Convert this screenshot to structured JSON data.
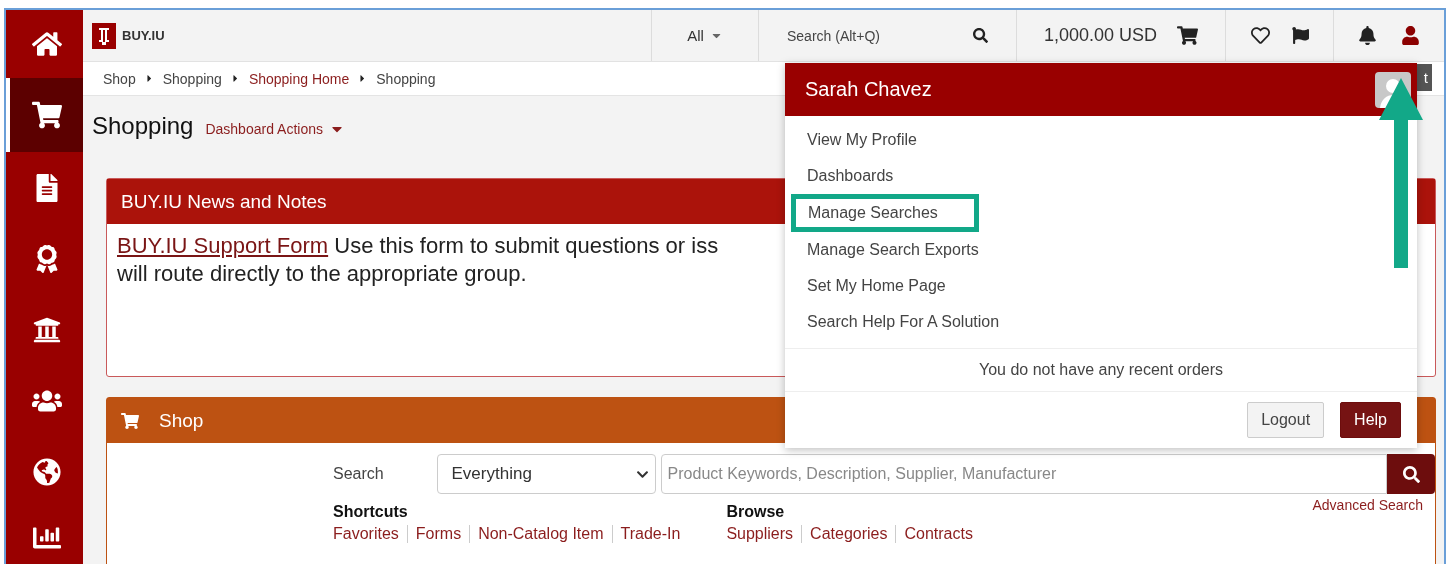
{
  "sidebar": {
    "items": [
      {
        "selected": false
      },
      {
        "selected": true
      },
      {
        "selected": false
      },
      {
        "selected": false
      },
      {
        "selected": false
      },
      {
        "selected": false
      },
      {
        "selected": false
      },
      {
        "selected": false
      }
    ]
  },
  "topbar": {
    "logo_text": "BUY.IU",
    "scope": "All",
    "search_placeholder": "Search (Alt+Q)",
    "cart_total": "1,000.00 USD"
  },
  "breadcrumb": [
    {
      "label": "Shop",
      "kind": "text"
    },
    {
      "label": "Shopping",
      "kind": "text"
    },
    {
      "label": "Shopping Home",
      "kind": "link"
    },
    {
      "label": "Shopping",
      "kind": "text"
    }
  ],
  "page_title": "Shopping",
  "page_actions": "Dashboard Actions",
  "news": {
    "title": "BUY.IU News and Notes",
    "link": "BUY.IU Support Form",
    "line_1": "Use this form to submit questions or iss",
    "line_2": "will route directly to the appropriate group."
  },
  "shop": {
    "title": "Shop",
    "search_label": "Search",
    "scope": "Everything",
    "placeholder": "Product Keywords, Description, Supplier, Manufacturer",
    "advanced": "Advanced Search",
    "groups": [
      {
        "title": "Shortcuts",
        "links": [
          "Favorites",
          "Forms",
          "Non-Catalog Item",
          "Trade-In"
        ]
      },
      {
        "title": "Browse",
        "links": [
          "Suppliers",
          "Categories",
          "Contracts"
        ]
      }
    ]
  },
  "covered_button": "t",
  "user_menu": {
    "name": "Sarah Chavez",
    "items": [
      {
        "label": "View My Profile",
        "annotated": false
      },
      {
        "label": "Dashboards",
        "annotated": false
      },
      {
        "label": "Manage Searches",
        "annotated": true
      },
      {
        "label": "Manage Search Exports",
        "annotated": false
      },
      {
        "label": "Set My Home Page",
        "annotated": false
      },
      {
        "label": "Search Help For A Solution",
        "annotated": false
      }
    ],
    "recent": "You do not have any recent orders",
    "buttons": [
      {
        "label": "Logout",
        "kind": "secondary"
      },
      {
        "label": "Help",
        "kind": "primary"
      }
    ],
    "annotation_arrow": true
  }
}
